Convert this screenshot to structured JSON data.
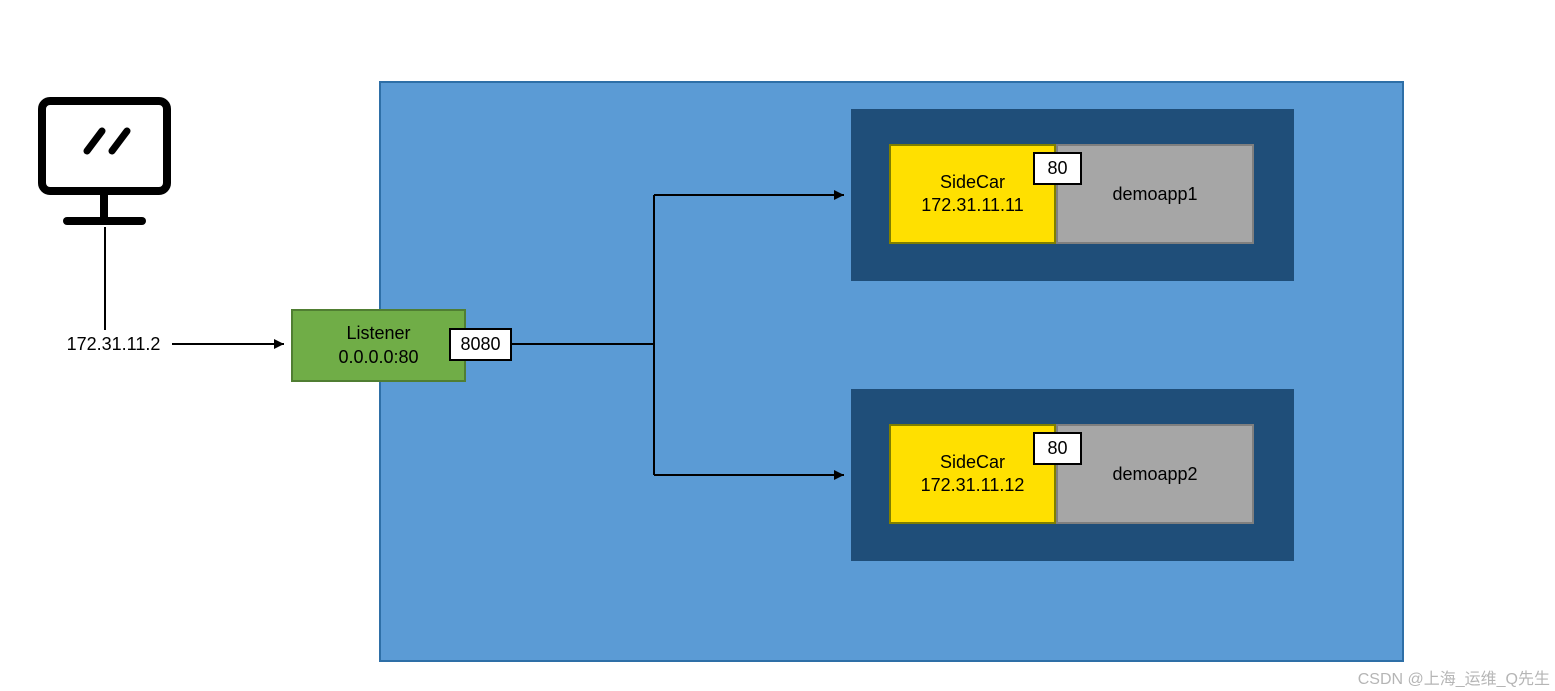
{
  "client": {
    "ip": "172.31.11.2"
  },
  "listener": {
    "title": "Listener",
    "addr": "0.0.0.0:80",
    "port_badge": "8080"
  },
  "pods": [
    {
      "sidecar_title": "SideCar",
      "sidecar_ip": "172.31.11.11",
      "port_badge": "80",
      "app_name": "demoapp1"
    },
    {
      "sidecar_title": "SideCar",
      "sidecar_ip": "172.31.11.12",
      "port_badge": "80",
      "app_name": "demoapp2"
    }
  ],
  "watermark": "CSDN @上海_运维_Q先生"
}
